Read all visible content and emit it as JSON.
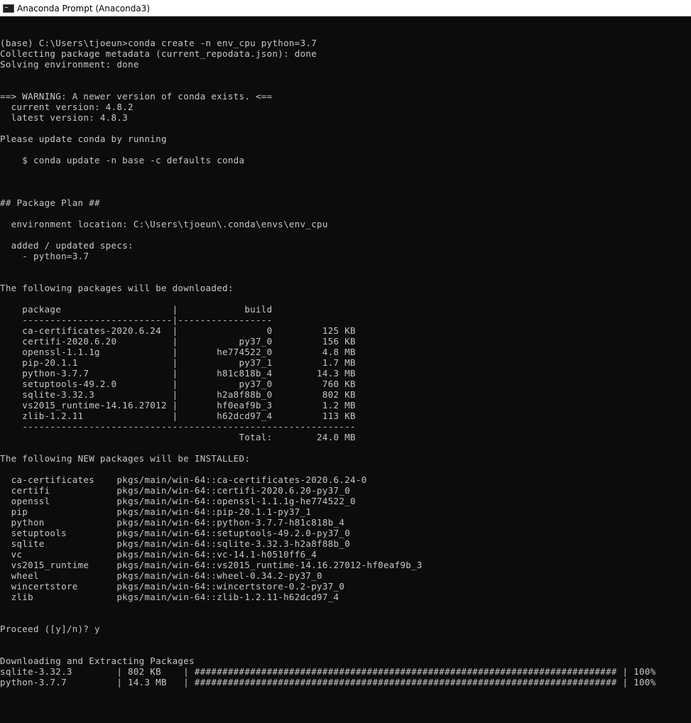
{
  "window": {
    "title": "Anaconda Prompt (Anaconda3)"
  },
  "console": {
    "lines": [
      "(base) C:\\Users\\tjoeun>conda create -n env_cpu python=3.7",
      "Collecting package metadata (current_repodata.json): done",
      "Solving environment: done",
      "",
      "",
      "==> WARNING: A newer version of conda exists. <==",
      "  current version: 4.8.2",
      "  latest version: 4.8.3",
      "",
      "Please update conda by running",
      "",
      "    $ conda update -n base -c defaults conda",
      "",
      "",
      "",
      "## Package Plan ##",
      "",
      "  environment location: C:\\Users\\tjoeun\\.conda\\envs\\env_cpu",
      "",
      "  added / updated specs:",
      "    - python=3.7",
      "",
      "",
      "The following packages will be downloaded:",
      "",
      "    package                    |            build",
      "    ---------------------------|-----------------",
      "    ca-certificates-2020.6.24  |                0         125 KB",
      "    certifi-2020.6.20          |           py37_0         156 KB",
      "    openssl-1.1.1g             |       he774522_0         4.8 MB",
      "    pip-20.1.1                 |           py37_1         1.7 MB",
      "    python-3.7.7               |       h81c818b_4        14.3 MB",
      "    setuptools-49.2.0          |           py37_0         760 KB",
      "    sqlite-3.32.3              |       h2a8f88b_0         802 KB",
      "    vs2015_runtime-14.16.27012 |       hf0eaf9b_3         1.2 MB",
      "    zlib-1.2.11                |       h62dcd97_4         113 KB",
      "    ------------------------------------------------------------",
      "                                           Total:        24.0 MB",
      "",
      "The following NEW packages will be INSTALLED:",
      "",
      "  ca-certificates    pkgs/main/win-64::ca-certificates-2020.6.24-0",
      "  certifi            pkgs/main/win-64::certifi-2020.6.20-py37_0",
      "  openssl            pkgs/main/win-64::openssl-1.1.1g-he774522_0",
      "  pip                pkgs/main/win-64::pip-20.1.1-py37_1",
      "  python             pkgs/main/win-64::python-3.7.7-h81c818b_4",
      "  setuptools         pkgs/main/win-64::setuptools-49.2.0-py37_0",
      "  sqlite             pkgs/main/win-64::sqlite-3.32.3-h2a8f88b_0",
      "  vc                 pkgs/main/win-64::vc-14.1-h0510ff6_4",
      "  vs2015_runtime     pkgs/main/win-64::vs2015_runtime-14.16.27012-hf0eaf9b_3",
      "  wheel              pkgs/main/win-64::wheel-0.34.2-py37_0",
      "  wincertstore       pkgs/main/win-64::wincertstore-0.2-py37_0",
      "  zlib               pkgs/main/win-64::zlib-1.2.11-h62dcd97_4",
      "",
      "",
      "Proceed ([y]/n)? y",
      "",
      "",
      "Downloading and Extracting Packages",
      "sqlite-3.32.3        | 802 KB    | ############################################################################ | 100%",
      "python-3.7.7         | 14.3 MB   | ############################################################################ | 100%"
    ]
  }
}
